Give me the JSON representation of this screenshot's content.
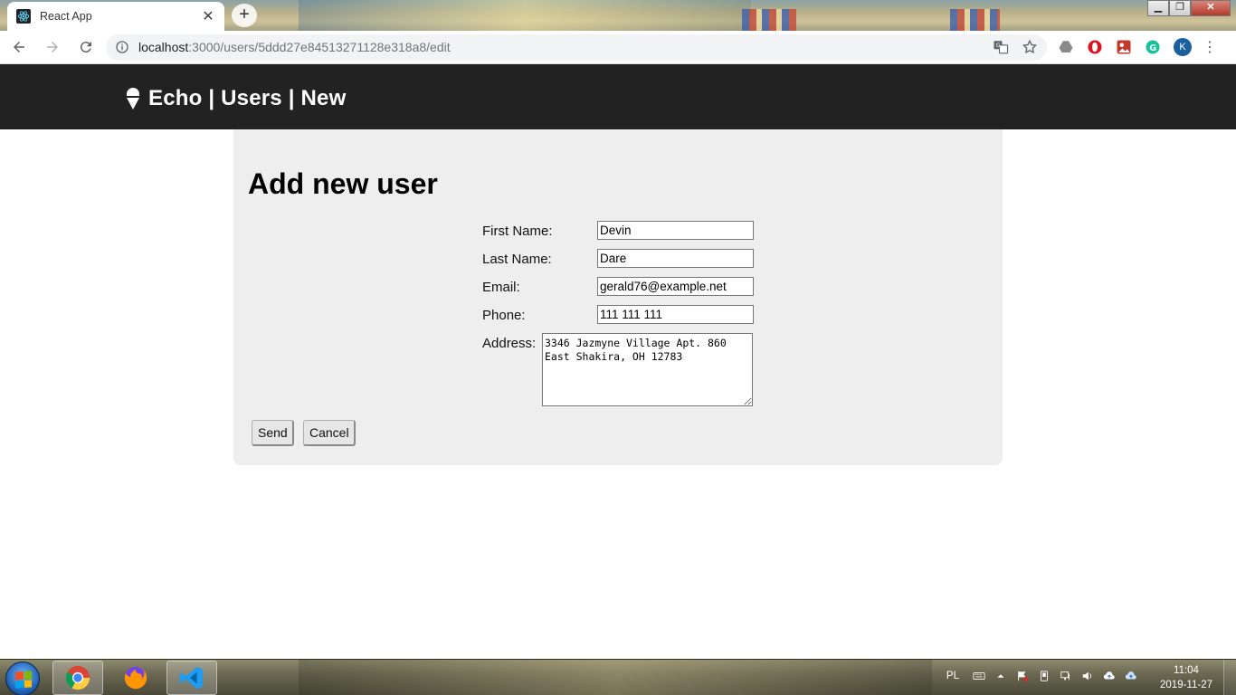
{
  "browser": {
    "tab_title": "React App",
    "tab_close": "✕",
    "new_tab": "+",
    "window_controls": {
      "minimize": "▁",
      "restore": "❐",
      "close": "✕"
    },
    "url_host": "localhost",
    "url_path": ":3000/users/5ddd27e84513271128e318a8/edit",
    "profile_initial": "K",
    "menu": "⋮"
  },
  "app": {
    "brand_title": "Echo | Users | New",
    "page_heading": "Add new user",
    "form": {
      "first_name_label": "First Name:",
      "first_name_value": "Devin",
      "last_name_label": "Last Name:",
      "last_name_value": "Dare",
      "email_label": "Email:",
      "email_value": "gerald76@example.net",
      "phone_label": "Phone:",
      "phone_value": "111 111 111",
      "address_label": "Address:",
      "address_value": "3346 Jazmyne Village Apt. 860\nEast Shakira, OH 12783",
      "send_label": "Send",
      "cancel_label": "Cancel"
    }
  },
  "taskbar": {
    "language": "PL",
    "time": "11:04",
    "date": "2019-11-27"
  },
  "colors": {
    "header_bg": "#222222",
    "panel_bg": "#eeeeee",
    "profile_bg": "#1a5f9e"
  }
}
